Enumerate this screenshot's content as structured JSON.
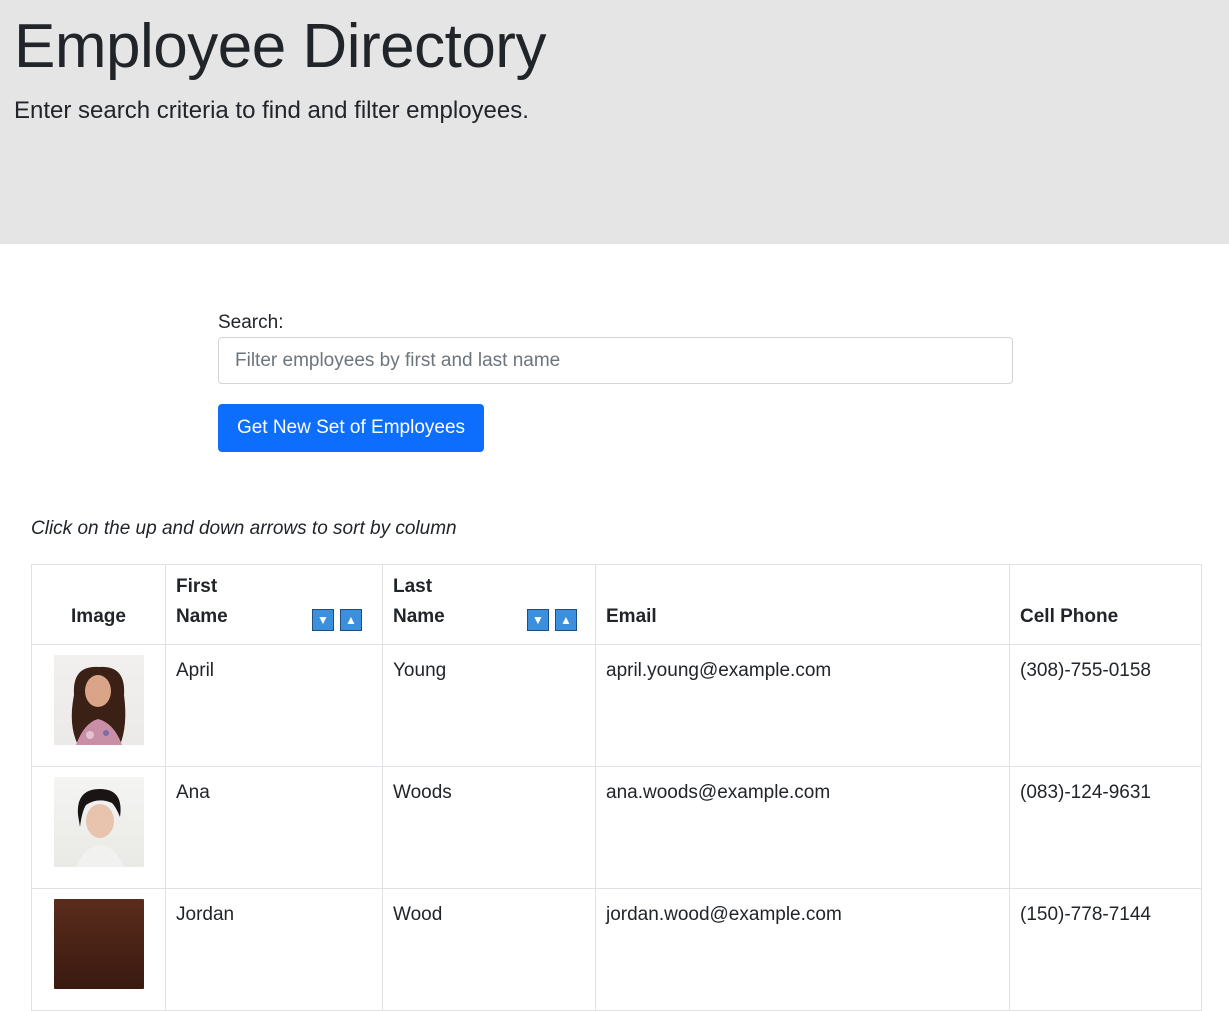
{
  "header": {
    "title": "Employee Directory",
    "subtitle": "Enter search criteria to find and filter employees."
  },
  "search": {
    "label": "Search:",
    "placeholder": "Filter employees by first and last name",
    "value": ""
  },
  "new_set_button": "Get New Set of Employees",
  "sort_hint": "Click on the up and down arrows to sort by column",
  "table": {
    "headers": {
      "image": "Image",
      "first_name_line1": "First",
      "first_name_line2": "Name",
      "last_name_line1": "Last",
      "last_name_line2": "Name",
      "email": "Email",
      "cell_phone": "Cell Phone"
    },
    "sort_icons": {
      "down": "▼",
      "up": "▲"
    },
    "rows": [
      {
        "first": "April",
        "last": "Young",
        "email": "april.young@example.com",
        "phone": "(308)-755-0158"
      },
      {
        "first": "Ana",
        "last": "Woods",
        "email": "ana.woods@example.com",
        "phone": "(083)-124-9631"
      },
      {
        "first": "Jordan",
        "last": "Wood",
        "email": "jordan.wood@example.com",
        "phone": "(150)-778-7144"
      }
    ]
  },
  "colors": {
    "header_bg": "#e5e5e5",
    "primary_button": "#0d6efd",
    "sort_button": "#3b8fdc",
    "table_border": "#dee2e6"
  }
}
